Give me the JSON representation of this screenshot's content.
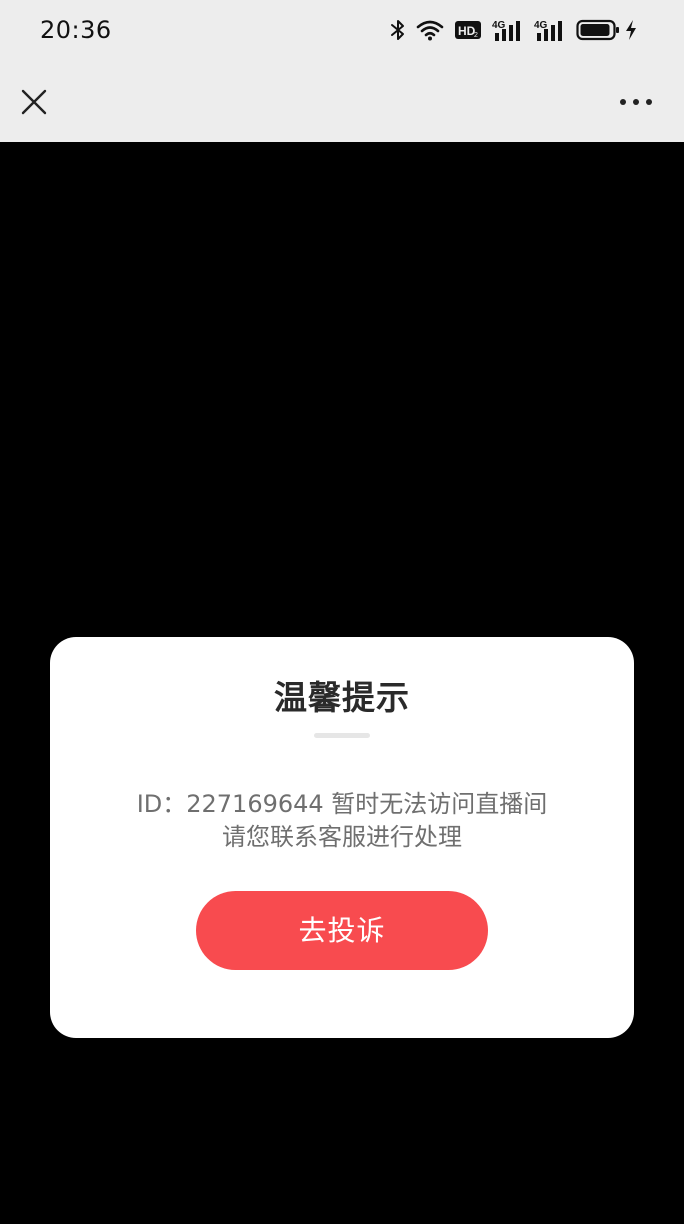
{
  "status_bar": {
    "time": "20:36",
    "hd_label": "HD",
    "network_label_1": "4G",
    "network_label_2": "4G",
    "icons": [
      "bluetooth-icon",
      "wifi-icon",
      "hd-icon",
      "signal-4g-icon",
      "signal-4g-icon",
      "battery-icon",
      "charging-icon"
    ]
  },
  "nav_bar": {
    "close_icon": "close-icon",
    "more_icon": "more-icon"
  },
  "dialog": {
    "title": "温馨提示",
    "message_line1": "ID：227169644 暂时无法访问直播间",
    "message_line2": "请您联系客服进行处理",
    "button_label": "去投诉"
  },
  "colors": {
    "topbar_bg": "#ededed",
    "page_bg": "#000000",
    "dialog_bg": "#ffffff",
    "button_bg": "#f84b4f",
    "title_text": "#2a2a2a",
    "message_text": "#6f6f6f"
  }
}
